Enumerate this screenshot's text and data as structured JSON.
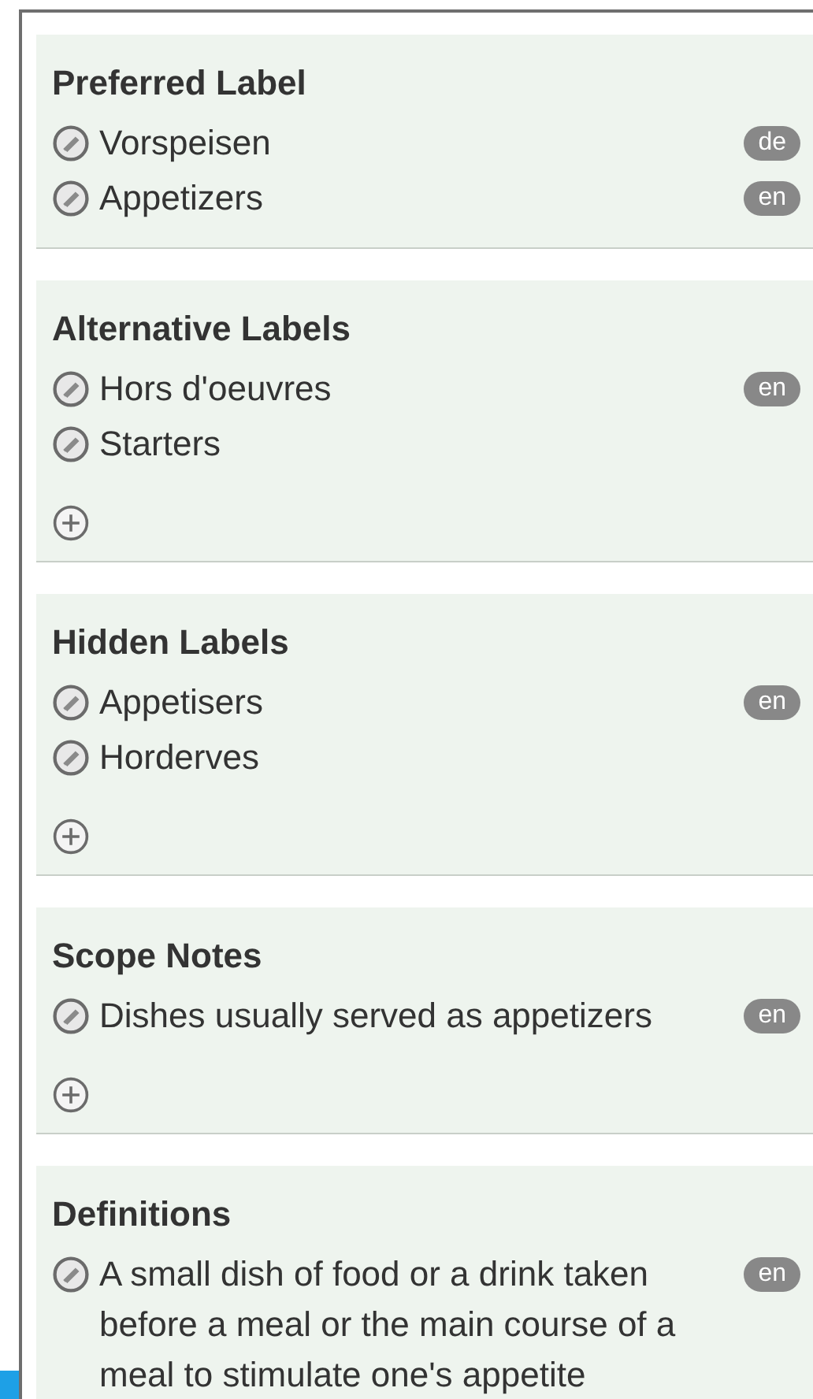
{
  "sections": [
    {
      "title": "Preferred Label",
      "add_button": false,
      "entries": [
        {
          "text": "Vorspeisen",
          "lang": "de"
        },
        {
          "text": "Appetizers",
          "lang": "en"
        }
      ]
    },
    {
      "title": "Alternative Labels",
      "add_button": true,
      "entries": [
        {
          "text": "Hors d'oeuvres",
          "lang": "en"
        },
        {
          "text": "Starters"
        }
      ]
    },
    {
      "title": "Hidden Labels",
      "add_button": true,
      "entries": [
        {
          "text": "Appetisers",
          "lang": "en"
        },
        {
          "text": "Horderves"
        }
      ]
    },
    {
      "title": "Scope Notes",
      "add_button": true,
      "entries": [
        {
          "text": "Dishes usually served as appetizers",
          "lang": "en"
        }
      ]
    },
    {
      "title": "Definitions",
      "add_button": false,
      "entries": [
        {
          "text": "A small dish of food or a drink taken before a meal or the main course of a meal to stimulate one's appetite",
          "lang": "en"
        }
      ]
    }
  ]
}
